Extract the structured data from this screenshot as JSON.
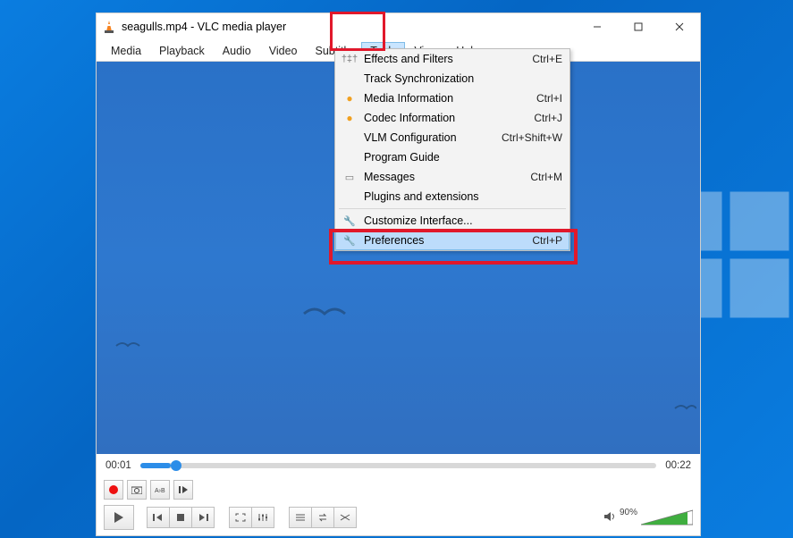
{
  "window": {
    "title": "seagulls.mp4 - VLC media player"
  },
  "menubar": [
    "Media",
    "Playback",
    "Audio",
    "Video",
    "Subtitle",
    "Tools",
    "View",
    "Help"
  ],
  "active_menu": "Tools",
  "dropdown": {
    "items": [
      {
        "icon": "sliders",
        "label": "Effects and Filters",
        "shortcut": "Ctrl+E"
      },
      {
        "icon": "",
        "label": "Track Synchronization",
        "shortcut": ""
      },
      {
        "icon": "warn",
        "label": "Media Information",
        "shortcut": "Ctrl+I"
      },
      {
        "icon": "warn",
        "label": "Codec Information",
        "shortcut": "Ctrl+J"
      },
      {
        "icon": "",
        "label": "VLM Configuration",
        "shortcut": "Ctrl+Shift+W"
      },
      {
        "icon": "",
        "label": "Program Guide",
        "shortcut": ""
      },
      {
        "icon": "msg",
        "label": "Messages",
        "shortcut": "Ctrl+M"
      },
      {
        "icon": "",
        "label": "Plugins and extensions",
        "shortcut": ""
      }
    ],
    "sep": true,
    "items2": [
      {
        "icon": "wrench",
        "label": "Customize Interface...",
        "shortcut": ""
      },
      {
        "icon": "wrench",
        "label": "Preferences",
        "shortcut": "Ctrl+P",
        "hover": true
      }
    ]
  },
  "playback": {
    "current": "00:01",
    "total": "00:22",
    "volume_pct": "90%"
  }
}
